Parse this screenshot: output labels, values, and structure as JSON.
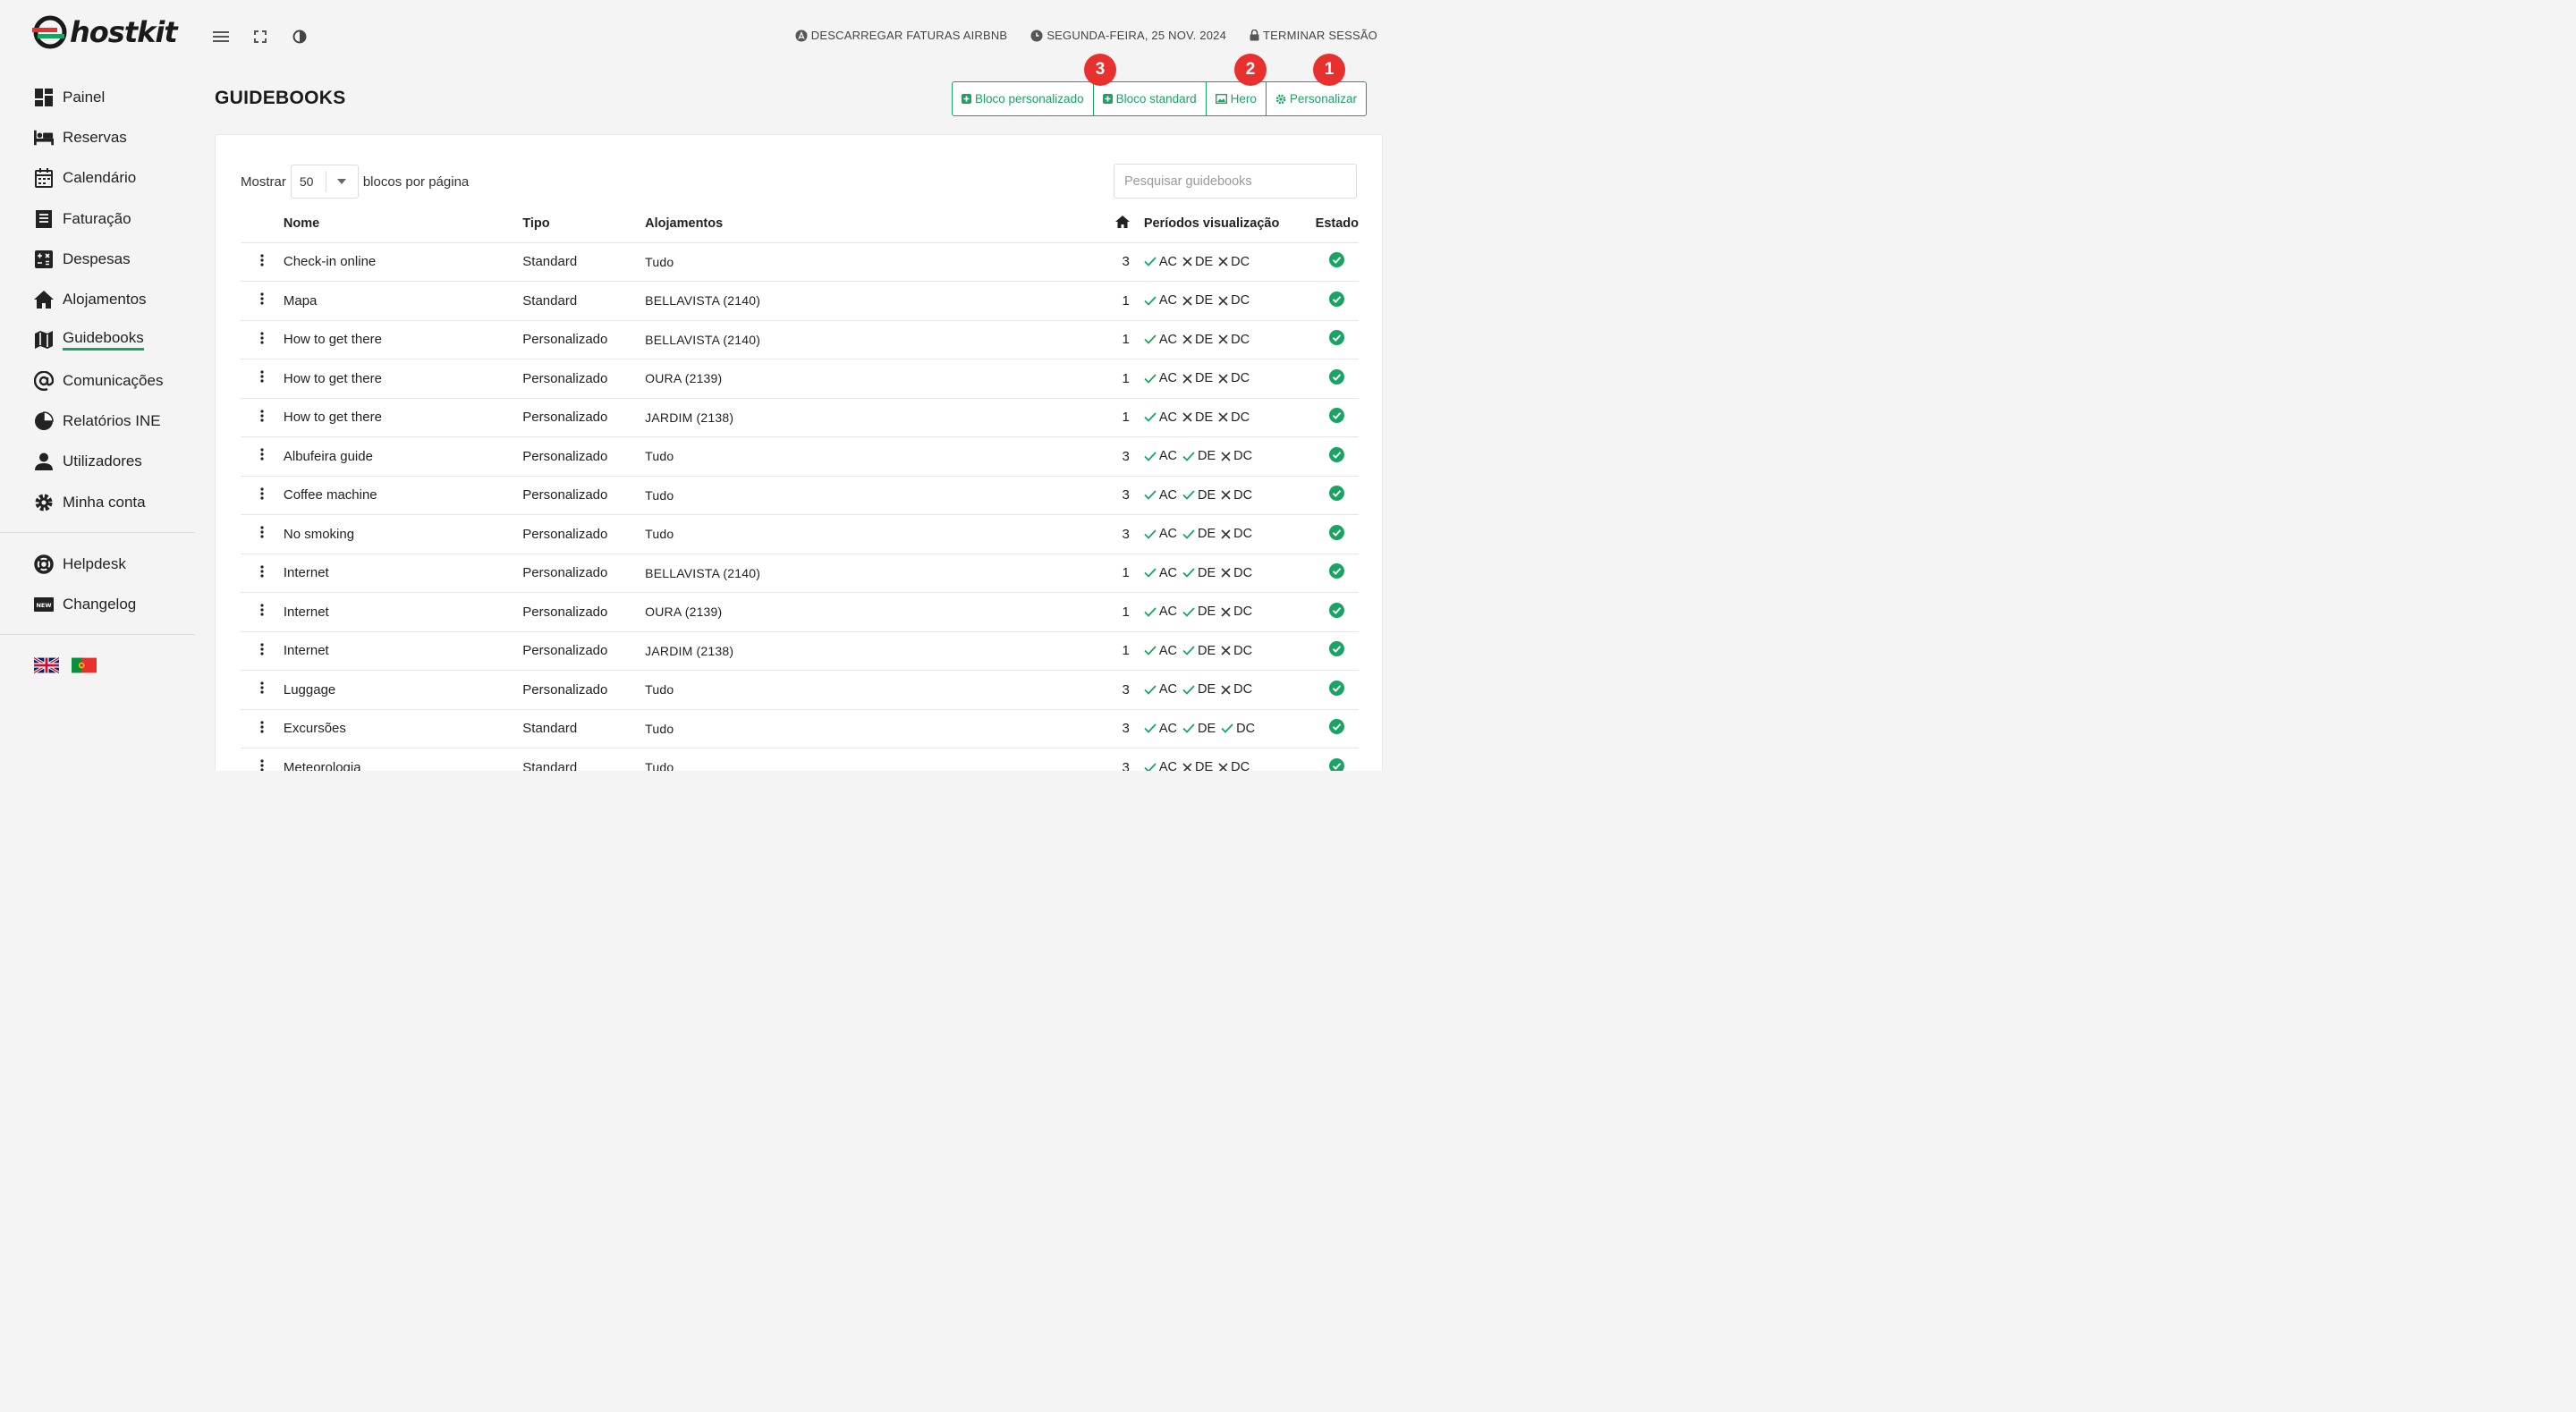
{
  "brand": {
    "name": "hostkit",
    "accent": "#19a463",
    "badge_color": "#e8312f"
  },
  "sidebar": {
    "items": [
      {
        "label": "Painel",
        "icon": "dashboard-icon"
      },
      {
        "label": "Reservas",
        "icon": "bed-icon"
      },
      {
        "label": "Calendário",
        "icon": "calendar-icon"
      },
      {
        "label": "Faturação",
        "icon": "invoice-icon"
      },
      {
        "label": "Despesas",
        "icon": "calculator-icon"
      },
      {
        "label": "Alojamentos",
        "icon": "home-icon"
      },
      {
        "label": "Guidebooks",
        "icon": "map-icon",
        "active": true
      },
      {
        "label": "Comunicações",
        "icon": "at-icon"
      },
      {
        "label": "Relatórios INE",
        "icon": "pie-chart-icon"
      },
      {
        "label": "Utilizadores",
        "icon": "user-icon"
      },
      {
        "label": "Minha conta",
        "icon": "gear-icon"
      }
    ],
    "secondary": [
      {
        "label": "Helpdesk",
        "icon": "lifebuoy-icon"
      },
      {
        "label": "Changelog",
        "icon": "new-icon"
      }
    ],
    "flags": [
      "uk-flag-icon",
      "portugal-flag-icon"
    ]
  },
  "topbar": {
    "download_label": "DESCARREGAR FATURAS AIRBNB",
    "date_label": "SEGUNDA-FEIRA, 25 NOV. 2024",
    "logout_label": "TERMINAR SESSÃO"
  },
  "page": {
    "title": "GUIDEBOOKS",
    "buttons": {
      "custom_block": "Bloco personalizado",
      "standard_block": "Bloco standard",
      "hero": "Hero",
      "customize": "Personalizar"
    },
    "badges": [
      "3",
      "2",
      "1"
    ]
  },
  "table_controls": {
    "show_label": "Mostrar",
    "per_page_value": "50",
    "per_page_suffix": "blocos por página",
    "search_placeholder": "Pesquisar guidebooks"
  },
  "table": {
    "headers": {
      "name": "Nome",
      "type": "Tipo",
      "properties": "Alojamentos",
      "periods": "Períodos visualização",
      "state": "Estado"
    },
    "period_labels": [
      "AC",
      "DE",
      "DC"
    ],
    "rows": [
      {
        "name": "Check-in online",
        "type": "Standard",
        "properties": "Tudo",
        "count": "3",
        "periods": [
          true,
          false,
          false
        ],
        "active": true
      },
      {
        "name": "Mapa",
        "type": "Standard",
        "properties": "BELLAVISTA (2140)",
        "count": "1",
        "periods": [
          true,
          false,
          false
        ],
        "active": true
      },
      {
        "name": "How to get there",
        "type": "Personalizado",
        "properties": "BELLAVISTA (2140)",
        "count": "1",
        "periods": [
          true,
          false,
          false
        ],
        "active": true
      },
      {
        "name": "How to get there",
        "type": "Personalizado",
        "properties": "OURA (2139)",
        "count": "1",
        "periods": [
          true,
          false,
          false
        ],
        "active": true
      },
      {
        "name": "How to get there",
        "type": "Personalizado",
        "properties": "JARDIM (2138)",
        "count": "1",
        "periods": [
          true,
          false,
          false
        ],
        "active": true
      },
      {
        "name": "Albufeira guide",
        "type": "Personalizado",
        "properties": "Tudo",
        "count": "3",
        "periods": [
          true,
          true,
          false
        ],
        "active": true
      },
      {
        "name": "Coffee machine",
        "type": "Personalizado",
        "properties": "Tudo",
        "count": "3",
        "periods": [
          true,
          true,
          false
        ],
        "active": true
      },
      {
        "name": "No smoking",
        "type": "Personalizado",
        "properties": "Tudo",
        "count": "3",
        "periods": [
          true,
          true,
          false
        ],
        "active": true
      },
      {
        "name": "Internet",
        "type": "Personalizado",
        "properties": "BELLAVISTA (2140)",
        "count": "1",
        "periods": [
          true,
          true,
          false
        ],
        "active": true
      },
      {
        "name": "Internet",
        "type": "Personalizado",
        "properties": "OURA (2139)",
        "count": "1",
        "periods": [
          true,
          true,
          false
        ],
        "active": true
      },
      {
        "name": "Internet",
        "type": "Personalizado",
        "properties": "JARDIM (2138)",
        "count": "1",
        "periods": [
          true,
          true,
          false
        ],
        "active": true
      },
      {
        "name": "Luggage",
        "type": "Personalizado",
        "properties": "Tudo",
        "count": "3",
        "periods": [
          true,
          true,
          false
        ],
        "active": true
      },
      {
        "name": "Excursões",
        "type": "Standard",
        "properties": "Tudo",
        "count": "3",
        "periods": [
          true,
          true,
          true
        ],
        "active": true
      },
      {
        "name": "Meteorologia",
        "type": "Standard",
        "properties": "Tudo",
        "count": "3",
        "periods": [
          true,
          false,
          false
        ],
        "active": true
      }
    ]
  }
}
